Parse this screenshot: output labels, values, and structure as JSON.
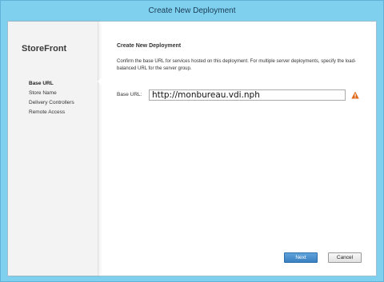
{
  "window": {
    "title": "Create New Deployment"
  },
  "sidebar": {
    "brand": "StoreFront",
    "items": [
      {
        "label": "Base URL",
        "active": true
      },
      {
        "label": "Store Name",
        "active": false
      },
      {
        "label": "Delivery Controllers",
        "active": false
      },
      {
        "label": "Remote Access",
        "active": false
      }
    ]
  },
  "main": {
    "heading": "Create New Deployment",
    "description": "Confirm the base URL for services hosted on this deployment. For multiple server deployments, specify the load-balanced URL for the server group.",
    "base_url_label": "Base URL:",
    "base_url_value": "http://monbureau.vdi.nph",
    "warning_icon": "warning-triangle",
    "warning_color": "#e06a1a"
  },
  "buttons": {
    "next": "Next",
    "cancel": "Cancel"
  },
  "colors": {
    "frame": "#7fd0ef",
    "accent": "#3a7fc0"
  }
}
